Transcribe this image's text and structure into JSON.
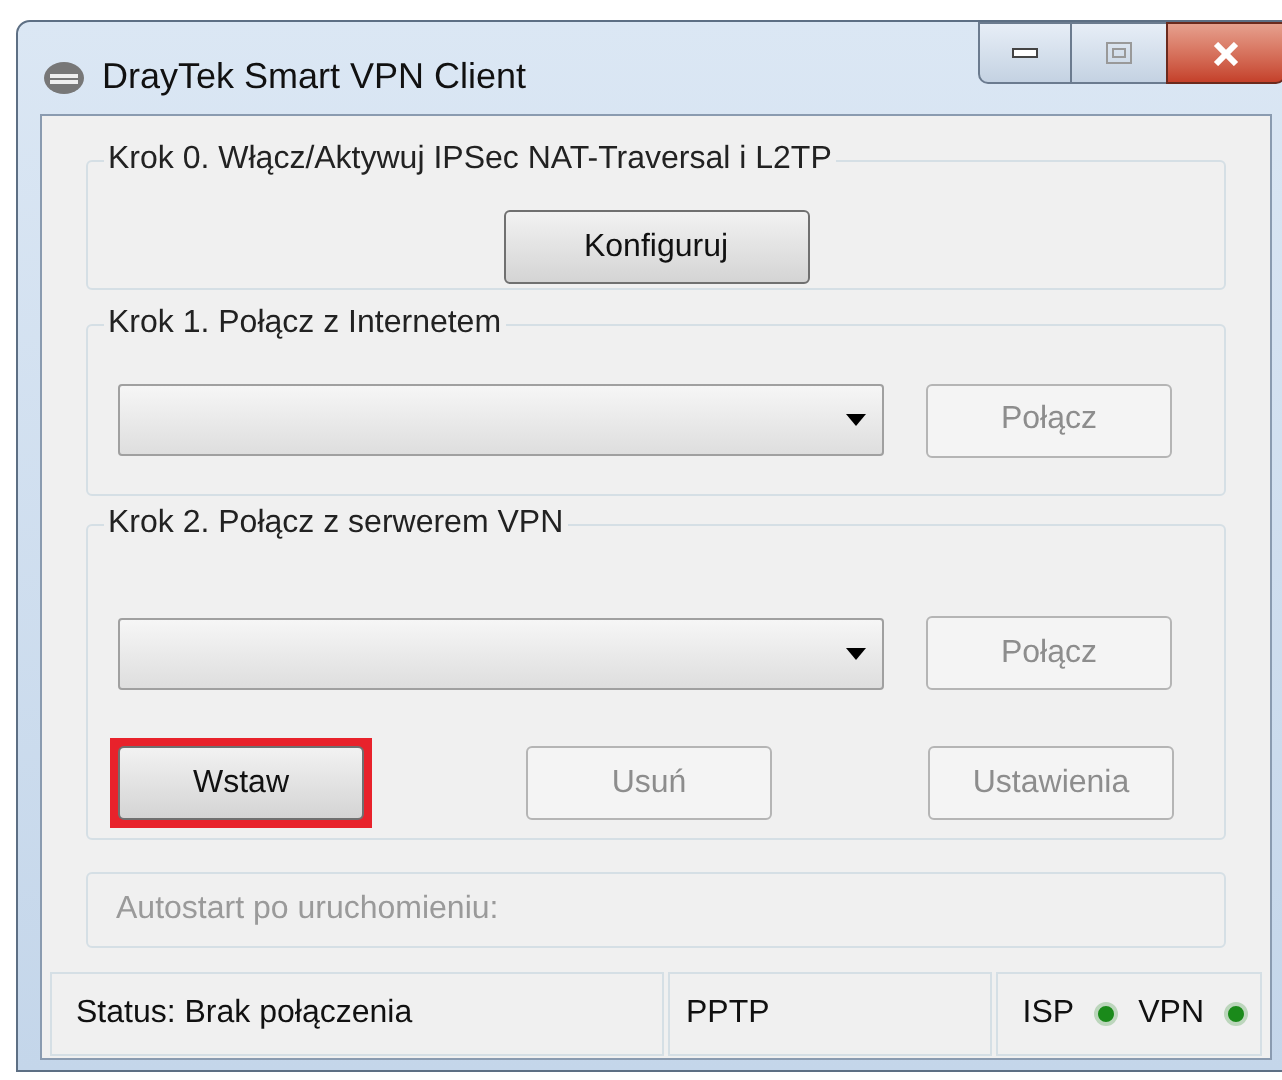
{
  "window": {
    "title": "DrayTek Smart VPN Client"
  },
  "step0": {
    "title": "Krok 0. Włącz/Aktywuj IPSec NAT-Traversal i L2TP",
    "button": "Konfiguruj"
  },
  "step1": {
    "title": "Krok 1. Połącz z Internetem",
    "connect": {
      "label": "Połącz",
      "disabled": true
    }
  },
  "step2": {
    "title": "Krok 2. Połącz z serwerem VPN",
    "connect": {
      "label": "Połącz",
      "disabled": true
    },
    "buttons": [
      {
        "label": "Wstaw",
        "disabled": false,
        "highlighted": true
      },
      {
        "label": "Usuń",
        "disabled": true,
        "highlighted": false
      },
      {
        "label": "Ustawienia",
        "disabled": true,
        "highlighted": false
      }
    ]
  },
  "autostart": {
    "label": "Autostart po uruchomieniu:",
    "disabled": true
  },
  "status_bar": {
    "status": "Status: Brak połączenia",
    "protocol": "PPTP",
    "indicators": [
      {
        "label": "ISP",
        "color": "#1a8a1a"
      },
      {
        "label": "VPN",
        "color": "#1a8a1a"
      }
    ]
  }
}
